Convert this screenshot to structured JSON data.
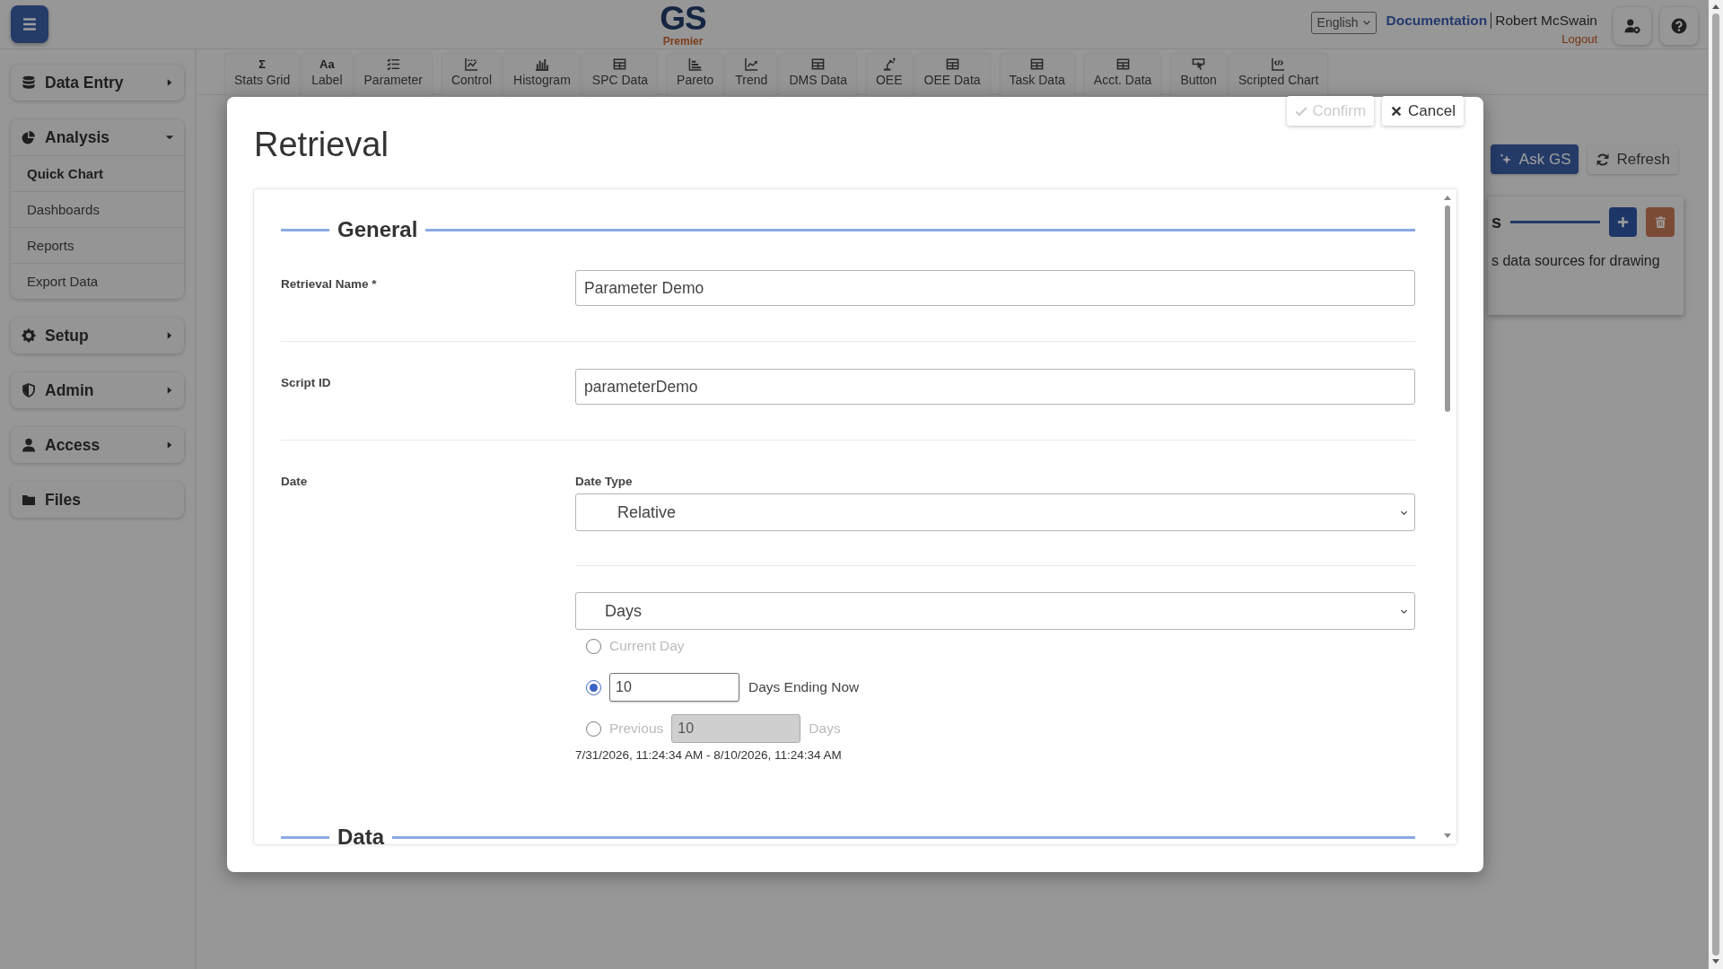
{
  "header": {
    "logo": {
      "title": "GS",
      "subtitle": "Premier"
    },
    "language": "English",
    "documentation": "Documentation",
    "user": "Robert McSwain",
    "logout": "Logout"
  },
  "sidebar": {
    "sections": [
      {
        "kind": "group",
        "label": "Data Entry",
        "expanded": false
      },
      {
        "kind": "group",
        "label": "Analysis",
        "expanded": true,
        "items": [
          {
            "label": "Quick Chart",
            "selected": true
          },
          {
            "label": "Dashboards",
            "selected": false
          },
          {
            "label": "Reports",
            "selected": false
          },
          {
            "label": "Export Data",
            "selected": false
          }
        ]
      },
      {
        "kind": "group",
        "label": "Setup",
        "expanded": false
      },
      {
        "kind": "group",
        "label": "Admin",
        "expanded": false
      },
      {
        "kind": "group",
        "label": "Access",
        "expanded": false
      },
      {
        "kind": "link",
        "label": "Files"
      }
    ]
  },
  "toolbar": {
    "groups": [
      [
        {
          "label": "Stats Grid",
          "glyph": "Σ"
        },
        {
          "label": "Label",
          "glyph": "Aa"
        },
        {
          "label": "Parameter"
        }
      ],
      [
        {
          "label": "Control"
        },
        {
          "label": "Histogram"
        },
        {
          "label": "SPC Data"
        }
      ],
      [
        {
          "label": "Pareto"
        },
        {
          "label": "Trend"
        },
        {
          "label": "DMS Data"
        }
      ],
      [
        {
          "label": "OEE"
        },
        {
          "label": "OEE Data"
        }
      ],
      [
        {
          "label": "Task Data"
        }
      ],
      [
        {
          "label": "Acct. Data"
        }
      ],
      [
        {
          "label": "Button"
        },
        {
          "label": "Scripted Chart"
        }
      ]
    ]
  },
  "content": {
    "ask_button": "Ask GS",
    "refresh_button": "Refresh",
    "card": {
      "heading": "s",
      "text": "s data sources for drawing"
    }
  },
  "modal": {
    "title": "Retrieval",
    "confirm": {
      "label": "Confirm",
      "disabled": true
    },
    "cancel": "Cancel",
    "sections": [
      {
        "title": "General",
        "rows": [
          {
            "kind": "text",
            "label": "Retrieval Name *",
            "value": "Parameter Demo"
          },
          {
            "kind": "text",
            "label": "Script ID",
            "value": "parameterDemo"
          },
          {
            "kind": "date",
            "label": "Date",
            "date_type_label": "Date Type",
            "date_type": "Relative",
            "unit": "Days",
            "options": [
              {
                "kind": "plain",
                "label": "Current Day",
                "selected": false
              },
              {
                "kind": "count",
                "value": "10",
                "suffix": "Days Ending Now",
                "selected": true
              },
              {
                "kind": "previous",
                "prefix": "Previous",
                "value": "10",
                "suffix": "Days",
                "selected": false
              }
            ],
            "range": "7/31/2026, 11:24:34 AM - 8/10/2026, 11:24:34 AM"
          }
        ]
      },
      {
        "title": "Data"
      }
    ]
  }
}
